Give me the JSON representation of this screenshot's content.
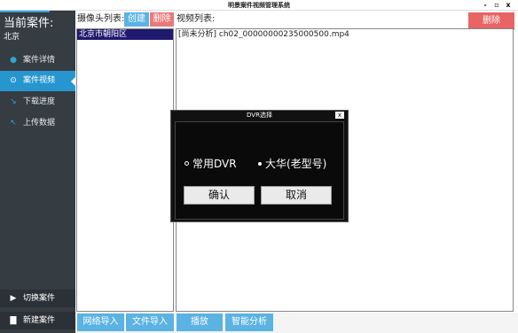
{
  "window": {
    "title": "明景案件视频管理系统",
    "minimize_glyph": "-",
    "maximize_glyph": "▫",
    "close_glyph": "x"
  },
  "sidebar": {
    "case_title": "当前案件:",
    "case_location": "北京",
    "items": [
      {
        "label": "案件详情",
        "icon": "pin-icon"
      },
      {
        "label": "案件视频",
        "icon": "play-circle-icon"
      },
      {
        "label": "下载进度",
        "icon": "arrow-down-icon"
      },
      {
        "label": "上传数据",
        "icon": "arrow-up-icon"
      }
    ],
    "bottom_items": [
      {
        "label": "切换案件",
        "icon": "play-icon"
      },
      {
        "label": "新建案件",
        "icon": "document-icon"
      }
    ]
  },
  "camera_panel": {
    "label": "摄像头列表:",
    "create_label": "创建",
    "delete_label": "删除",
    "rows": [
      "北京市朝阳区"
    ]
  },
  "video_panel": {
    "label": "视频列表:",
    "delete_label": "删除",
    "rows": [
      "[尚未分析] ch02_00000000235000500.mp4"
    ]
  },
  "toolbar": {
    "network_import": "网络导入",
    "file_import": "文件导入",
    "play": "播放",
    "smart_analysis": "智能分析"
  },
  "dialog": {
    "title": "DVR选择",
    "close_glyph": "x",
    "option1": "常用DVR",
    "option2": "大华(老型号)",
    "confirm": "确认",
    "cancel": "取消"
  },
  "colors": {
    "sidebar_bg": "#353c42",
    "accent_blue": "#2796cf",
    "button_blue": "#5ab3e3",
    "delete_red": "#e76565",
    "selection_navy": "#1f1a6e"
  }
}
